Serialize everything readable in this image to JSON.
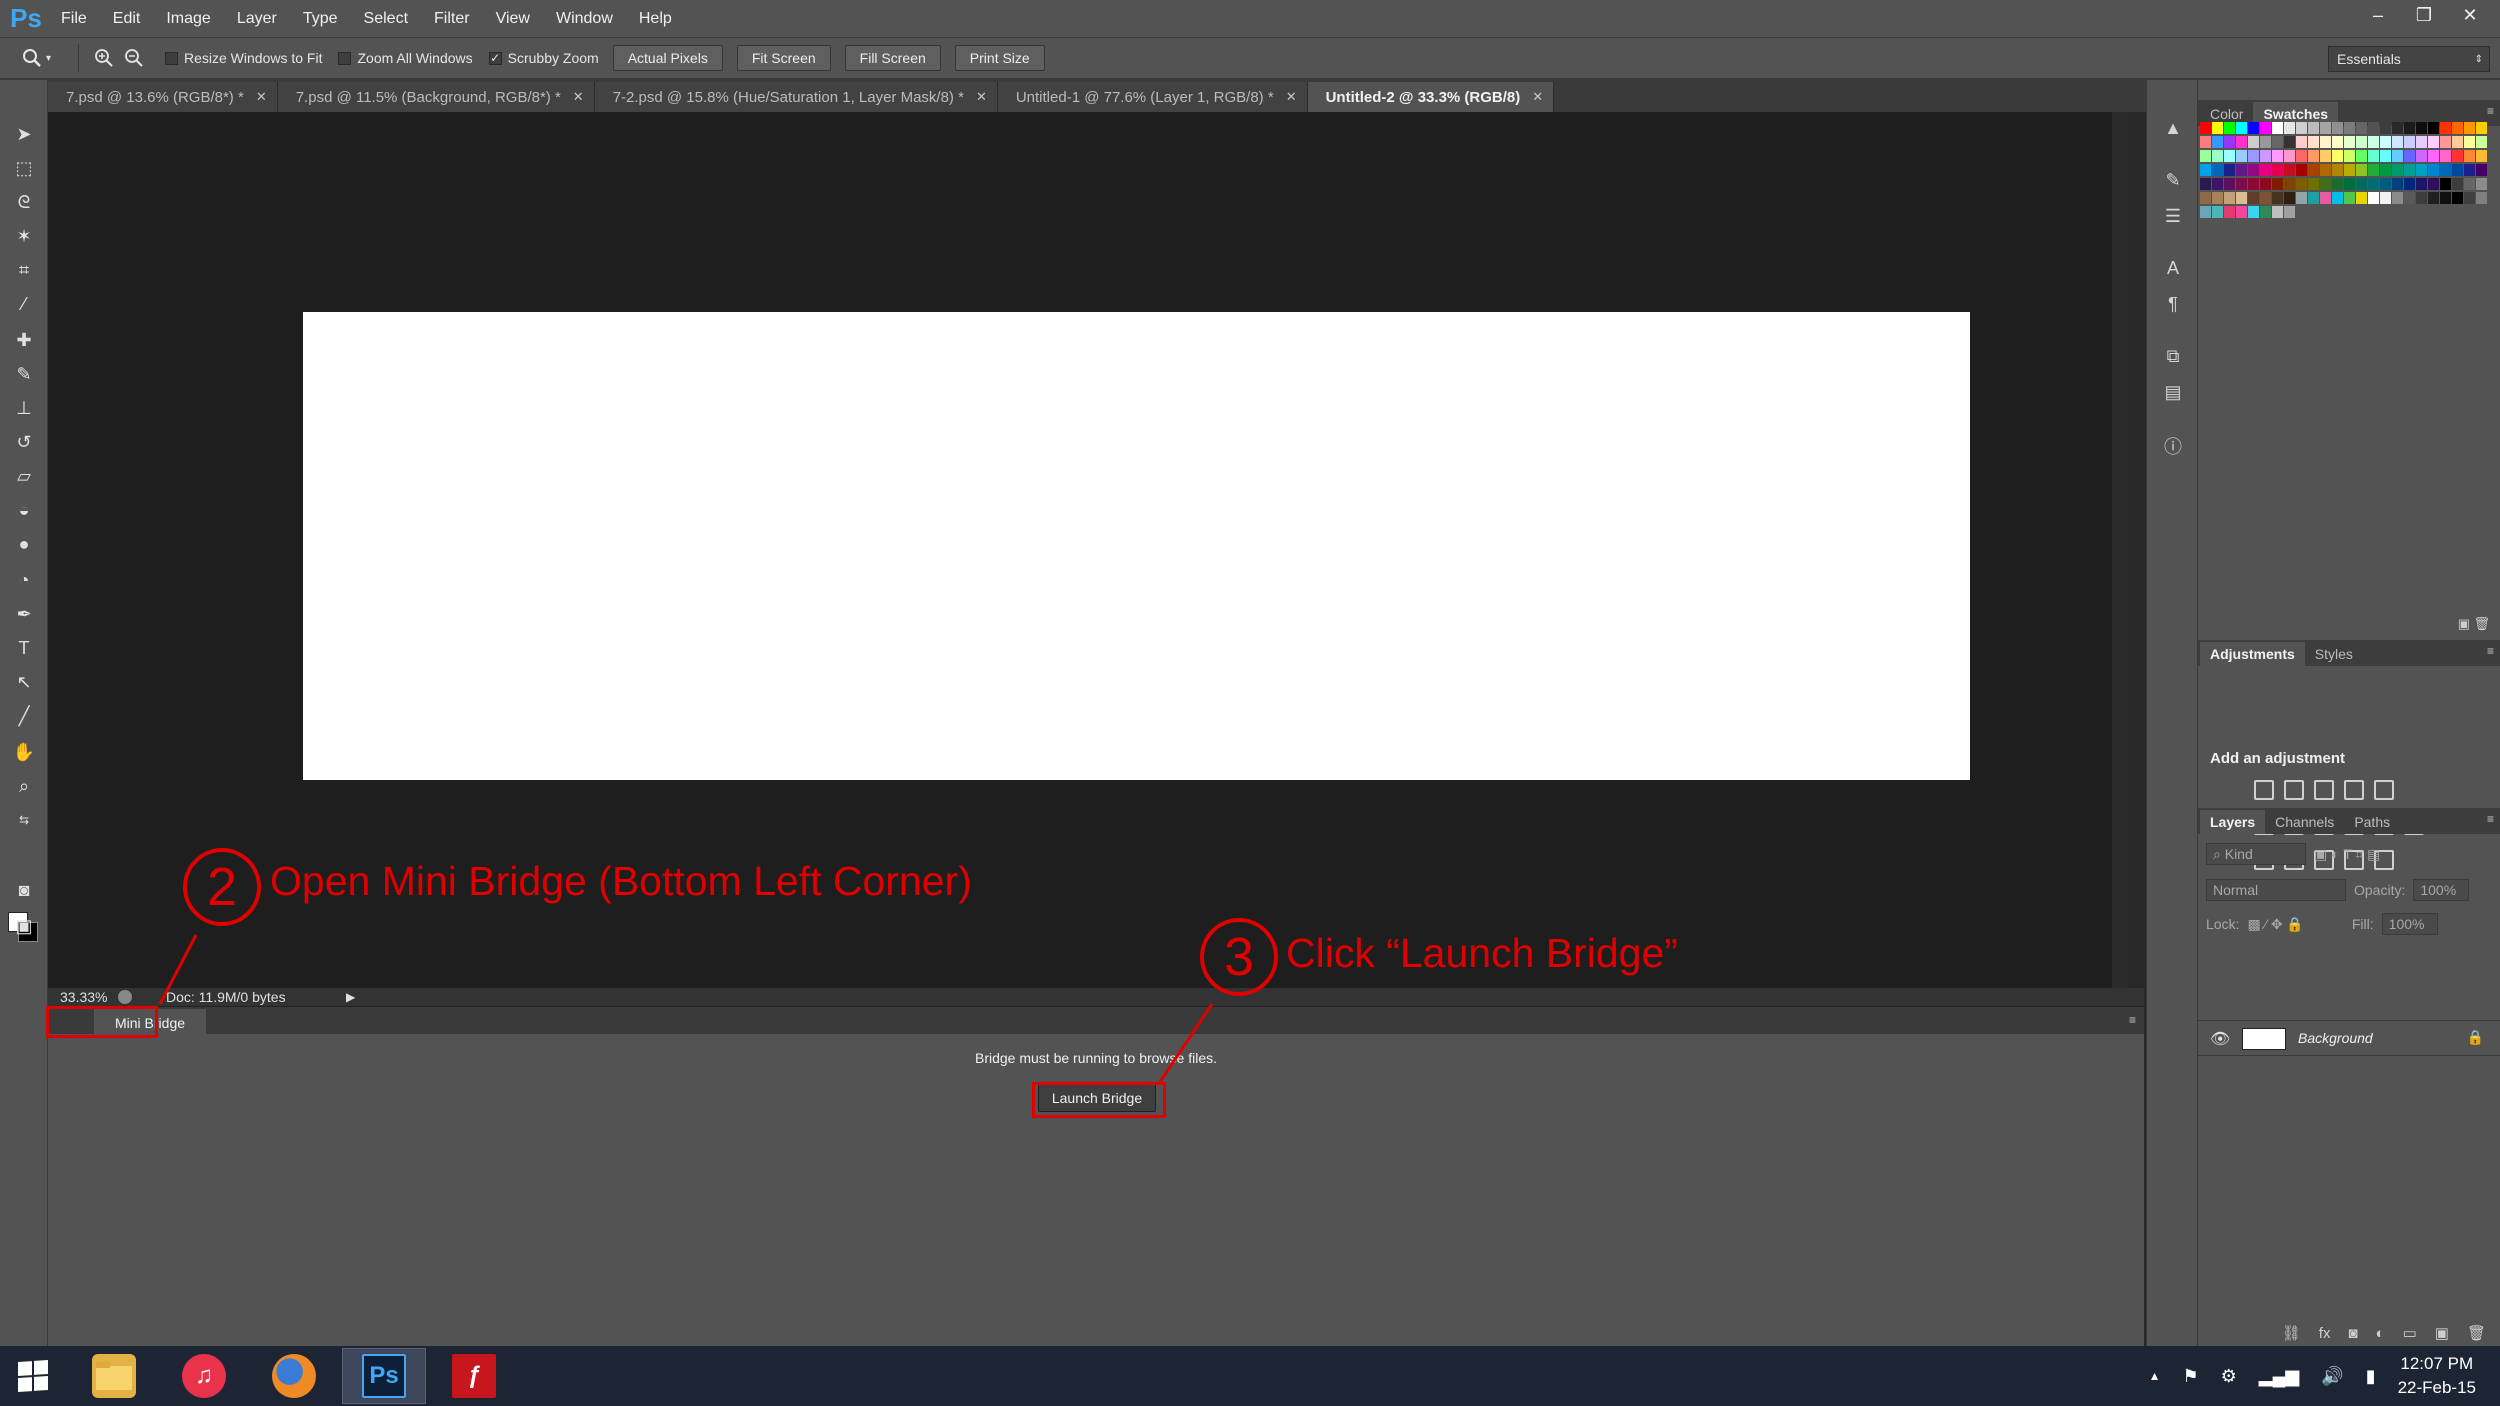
{
  "app": {
    "logo": "Ps"
  },
  "menu": [
    "File",
    "Edit",
    "Image",
    "Layer",
    "Type",
    "Select",
    "Filter",
    "View",
    "Window",
    "Help"
  ],
  "window_controls": {
    "minimize": "–",
    "restore": "❐",
    "close": "✕"
  },
  "options_bar": {
    "checks": [
      {
        "label": "Resize Windows to Fit",
        "checked": false
      },
      {
        "label": "Zoom All Windows",
        "checked": false
      },
      {
        "label": "Scrubby Zoom",
        "checked": true
      }
    ],
    "buttons": [
      "Actual Pixels",
      "Fit Screen",
      "Fill Screen",
      "Print Size"
    ],
    "workspace": "Essentials"
  },
  "doc_tabs": [
    {
      "label": "7.psd @ 13.6% (RGB/8*) *",
      "active": false
    },
    {
      "label": "7.psd @ 11.5% (Background, RGB/8*) *",
      "active": false
    },
    {
      "label": "7-2.psd @ 15.8% (Hue/Saturation 1, Layer Mask/8) *",
      "active": false
    },
    {
      "label": "Untitled-1 @ 77.6% (Layer 1, RGB/8) *",
      "active": false
    },
    {
      "label": "Untitled-2 @ 33.3% (RGB/8)",
      "active": true
    }
  ],
  "status": {
    "zoom": "33.33%",
    "doc": "Doc: 11.9M/0 bytes",
    "arrow": "▶"
  },
  "mini_bridge": {
    "tab": "Mini Bridge",
    "message": "Bridge must be running to browse files.",
    "button": "Launch Bridge"
  },
  "annotations": {
    "step2_num": "2",
    "step2_text": "Open Mini Bridge (Bottom Left Corner)",
    "step3_num": "3",
    "step3_text": "Click “Launch Bridge”",
    "color": "#e00000"
  },
  "panels": {
    "color_tabs": [
      "Color",
      "Swatches"
    ],
    "adjust_tabs": [
      "Adjustments",
      "Styles"
    ],
    "adjust_title": "Add an adjustment",
    "layers_tabs": [
      "Layers",
      "Channels",
      "Paths"
    ],
    "kind": "Kind",
    "blend": "Normal",
    "opacity_label": "Opacity:",
    "opacity": "100%",
    "lock_label": "Lock:",
    "fill_label": "Fill:",
    "fill": "100%",
    "layer_name": "Background"
  },
  "taskbar": {
    "apps": [
      {
        "name": "file-explorer",
        "glyph": "",
        "color": "#e2b245"
      },
      {
        "name": "itunes",
        "glyph": "♫",
        "color": "#e8334a"
      },
      {
        "name": "firefox",
        "glyph": "",
        "color": "#e66b1f"
      },
      {
        "name": "photoshop",
        "glyph": "Ps",
        "color": "#0e1f3a"
      },
      {
        "name": "flash",
        "glyph": "ƒ",
        "color": "#c8161d"
      }
    ],
    "time": "12:07 PM",
    "date": "22-Feb-15"
  }
}
